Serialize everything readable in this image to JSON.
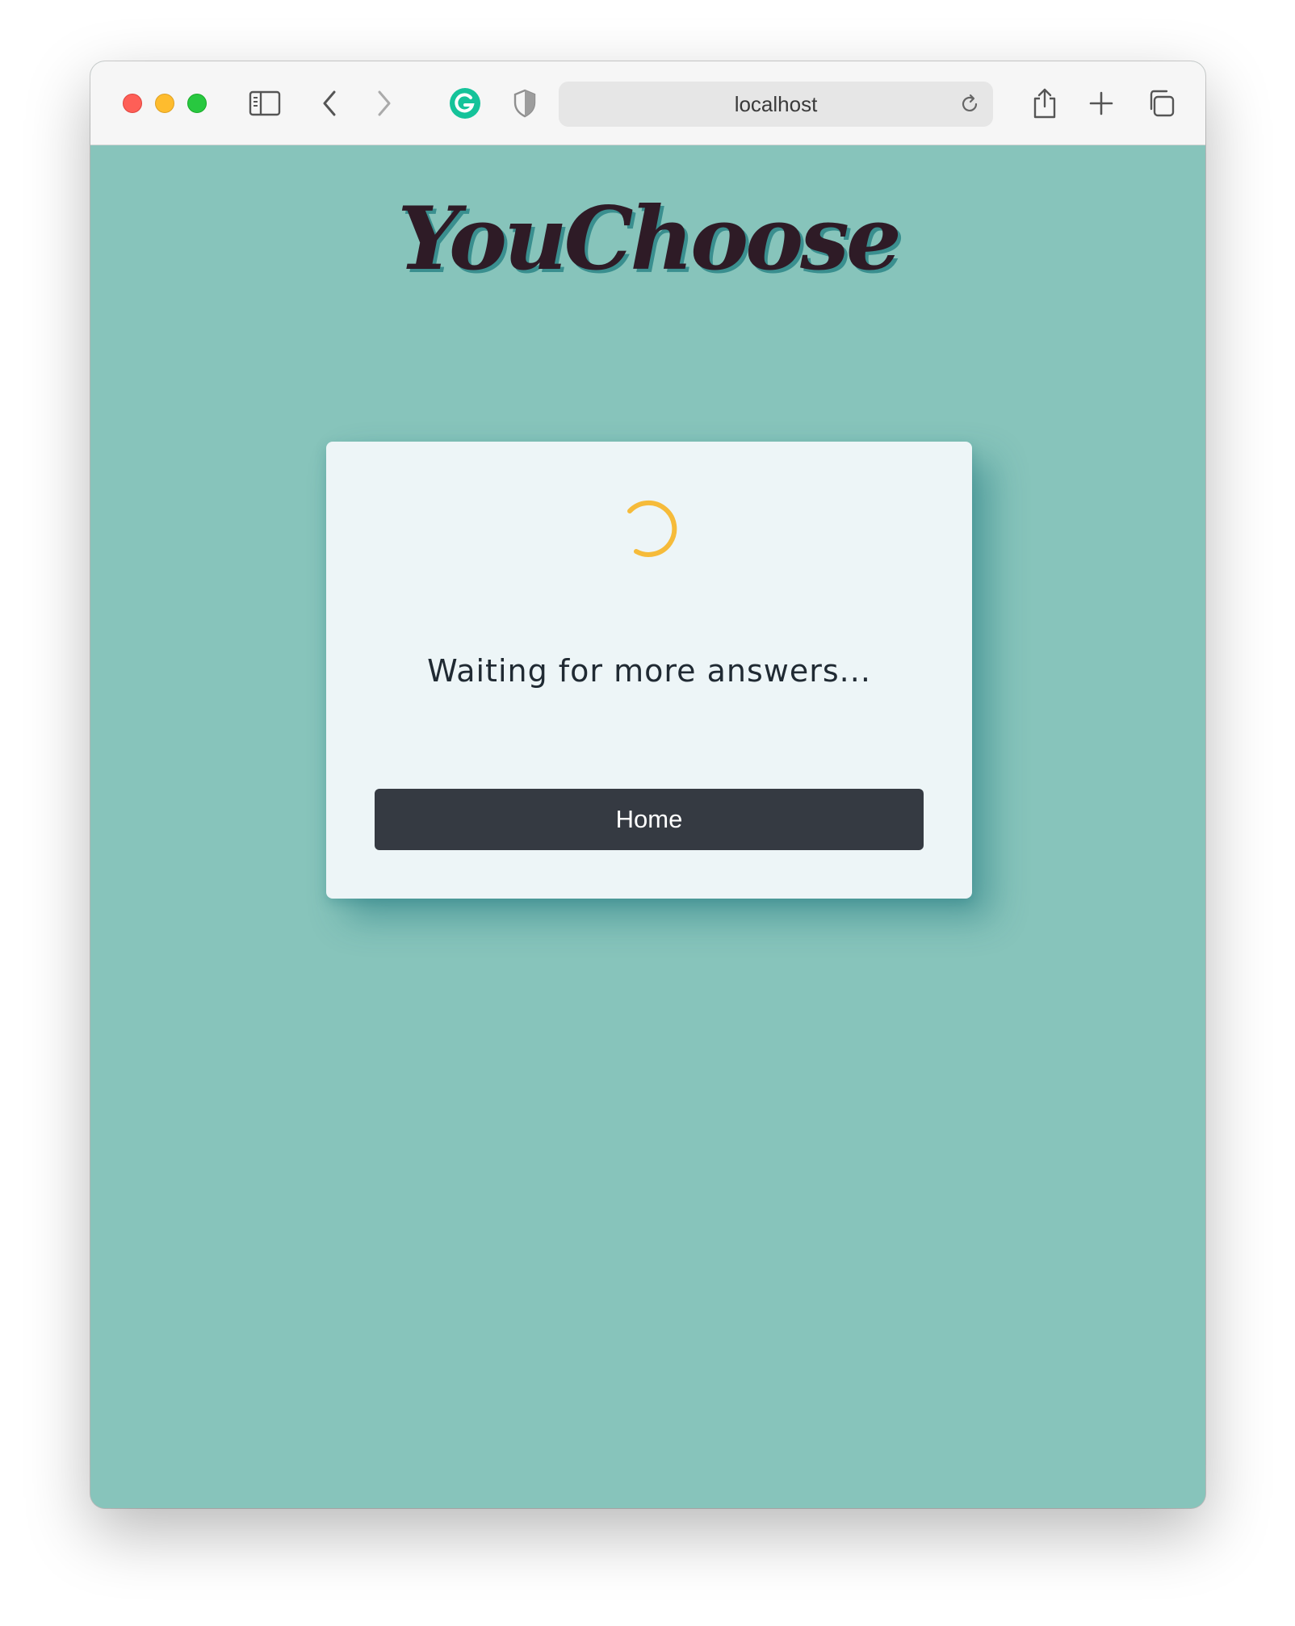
{
  "browser": {
    "url": "localhost",
    "icons": {
      "sidebar": "sidebar-icon",
      "back": "chevron-left-icon",
      "forward": "chevron-right-icon",
      "extension_1": "grammarly-icon",
      "extension_2": "shield-icon",
      "reload": "reload-icon",
      "share": "share-icon",
      "new_tab": "plus-icon",
      "tabs": "tabs-overview-icon"
    }
  },
  "page": {
    "logo": "YouChoose",
    "status_text": "Waiting for more answers...",
    "home_button_label": "Home"
  },
  "colors": {
    "background": "#87c4bb",
    "card": "#edf5f7",
    "spinner": "#f6bb3a",
    "button": "#353a42",
    "logo": "#2e1b26"
  }
}
